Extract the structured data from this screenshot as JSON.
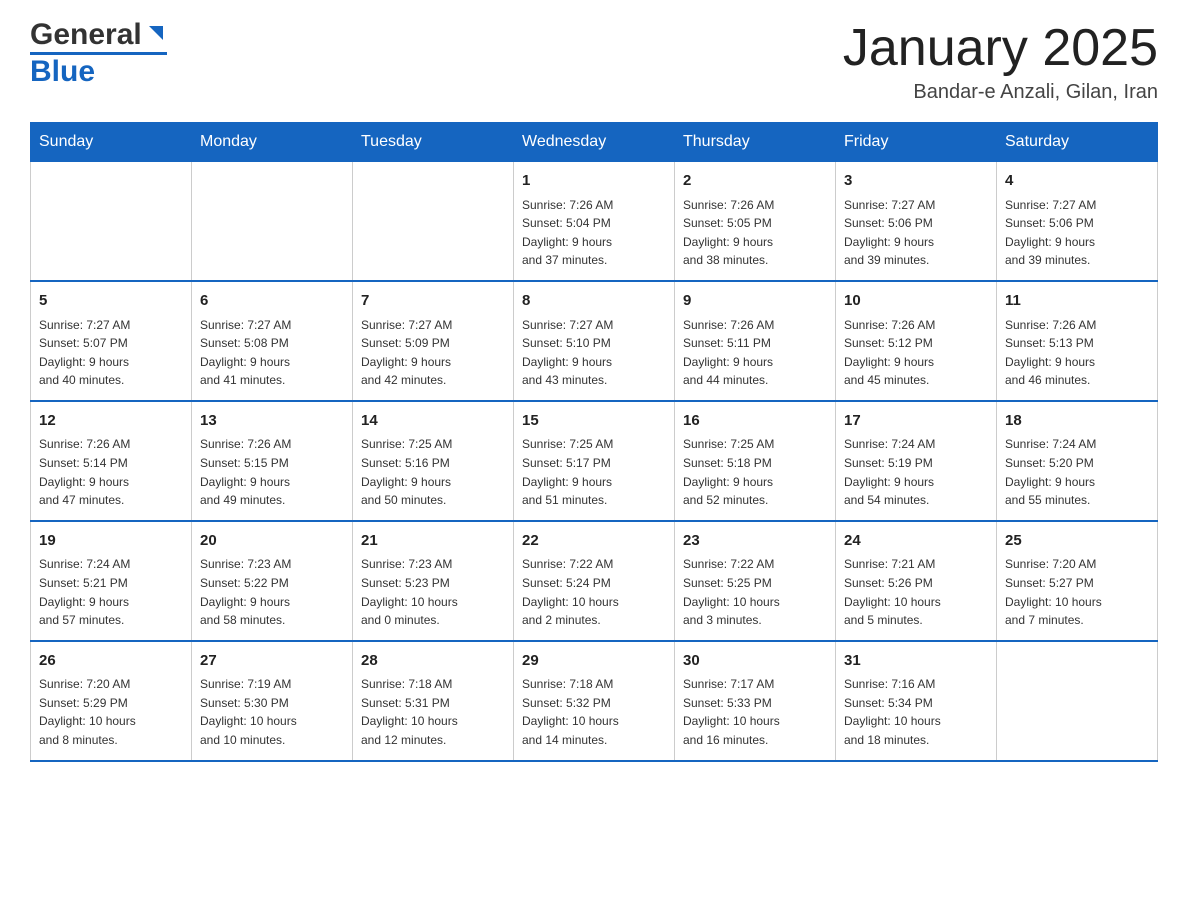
{
  "header": {
    "logo_general": "General",
    "logo_blue": "Blue",
    "title": "January 2025",
    "subtitle": "Bandar-e Anzali, Gilan, Iran"
  },
  "weekdays": [
    "Sunday",
    "Monday",
    "Tuesday",
    "Wednesday",
    "Thursday",
    "Friday",
    "Saturday"
  ],
  "weeks": [
    [
      {
        "day": "",
        "info": ""
      },
      {
        "day": "",
        "info": ""
      },
      {
        "day": "",
        "info": ""
      },
      {
        "day": "1",
        "info": "Sunrise: 7:26 AM\nSunset: 5:04 PM\nDaylight: 9 hours\nand 37 minutes."
      },
      {
        "day": "2",
        "info": "Sunrise: 7:26 AM\nSunset: 5:05 PM\nDaylight: 9 hours\nand 38 minutes."
      },
      {
        "day": "3",
        "info": "Sunrise: 7:27 AM\nSunset: 5:06 PM\nDaylight: 9 hours\nand 39 minutes."
      },
      {
        "day": "4",
        "info": "Sunrise: 7:27 AM\nSunset: 5:06 PM\nDaylight: 9 hours\nand 39 minutes."
      }
    ],
    [
      {
        "day": "5",
        "info": "Sunrise: 7:27 AM\nSunset: 5:07 PM\nDaylight: 9 hours\nand 40 minutes."
      },
      {
        "day": "6",
        "info": "Sunrise: 7:27 AM\nSunset: 5:08 PM\nDaylight: 9 hours\nand 41 minutes."
      },
      {
        "day": "7",
        "info": "Sunrise: 7:27 AM\nSunset: 5:09 PM\nDaylight: 9 hours\nand 42 minutes."
      },
      {
        "day": "8",
        "info": "Sunrise: 7:27 AM\nSunset: 5:10 PM\nDaylight: 9 hours\nand 43 minutes."
      },
      {
        "day": "9",
        "info": "Sunrise: 7:26 AM\nSunset: 5:11 PM\nDaylight: 9 hours\nand 44 minutes."
      },
      {
        "day": "10",
        "info": "Sunrise: 7:26 AM\nSunset: 5:12 PM\nDaylight: 9 hours\nand 45 minutes."
      },
      {
        "day": "11",
        "info": "Sunrise: 7:26 AM\nSunset: 5:13 PM\nDaylight: 9 hours\nand 46 minutes."
      }
    ],
    [
      {
        "day": "12",
        "info": "Sunrise: 7:26 AM\nSunset: 5:14 PM\nDaylight: 9 hours\nand 47 minutes."
      },
      {
        "day": "13",
        "info": "Sunrise: 7:26 AM\nSunset: 5:15 PM\nDaylight: 9 hours\nand 49 minutes."
      },
      {
        "day": "14",
        "info": "Sunrise: 7:25 AM\nSunset: 5:16 PM\nDaylight: 9 hours\nand 50 minutes."
      },
      {
        "day": "15",
        "info": "Sunrise: 7:25 AM\nSunset: 5:17 PM\nDaylight: 9 hours\nand 51 minutes."
      },
      {
        "day": "16",
        "info": "Sunrise: 7:25 AM\nSunset: 5:18 PM\nDaylight: 9 hours\nand 52 minutes."
      },
      {
        "day": "17",
        "info": "Sunrise: 7:24 AM\nSunset: 5:19 PM\nDaylight: 9 hours\nand 54 minutes."
      },
      {
        "day": "18",
        "info": "Sunrise: 7:24 AM\nSunset: 5:20 PM\nDaylight: 9 hours\nand 55 minutes."
      }
    ],
    [
      {
        "day": "19",
        "info": "Sunrise: 7:24 AM\nSunset: 5:21 PM\nDaylight: 9 hours\nand 57 minutes."
      },
      {
        "day": "20",
        "info": "Sunrise: 7:23 AM\nSunset: 5:22 PM\nDaylight: 9 hours\nand 58 minutes."
      },
      {
        "day": "21",
        "info": "Sunrise: 7:23 AM\nSunset: 5:23 PM\nDaylight: 10 hours\nand 0 minutes."
      },
      {
        "day": "22",
        "info": "Sunrise: 7:22 AM\nSunset: 5:24 PM\nDaylight: 10 hours\nand 2 minutes."
      },
      {
        "day": "23",
        "info": "Sunrise: 7:22 AM\nSunset: 5:25 PM\nDaylight: 10 hours\nand 3 minutes."
      },
      {
        "day": "24",
        "info": "Sunrise: 7:21 AM\nSunset: 5:26 PM\nDaylight: 10 hours\nand 5 minutes."
      },
      {
        "day": "25",
        "info": "Sunrise: 7:20 AM\nSunset: 5:27 PM\nDaylight: 10 hours\nand 7 minutes."
      }
    ],
    [
      {
        "day": "26",
        "info": "Sunrise: 7:20 AM\nSunset: 5:29 PM\nDaylight: 10 hours\nand 8 minutes."
      },
      {
        "day": "27",
        "info": "Sunrise: 7:19 AM\nSunset: 5:30 PM\nDaylight: 10 hours\nand 10 minutes."
      },
      {
        "day": "28",
        "info": "Sunrise: 7:18 AM\nSunset: 5:31 PM\nDaylight: 10 hours\nand 12 minutes."
      },
      {
        "day": "29",
        "info": "Sunrise: 7:18 AM\nSunset: 5:32 PM\nDaylight: 10 hours\nand 14 minutes."
      },
      {
        "day": "30",
        "info": "Sunrise: 7:17 AM\nSunset: 5:33 PM\nDaylight: 10 hours\nand 16 minutes."
      },
      {
        "day": "31",
        "info": "Sunrise: 7:16 AM\nSunset: 5:34 PM\nDaylight: 10 hours\nand 18 minutes."
      },
      {
        "day": "",
        "info": ""
      }
    ]
  ]
}
